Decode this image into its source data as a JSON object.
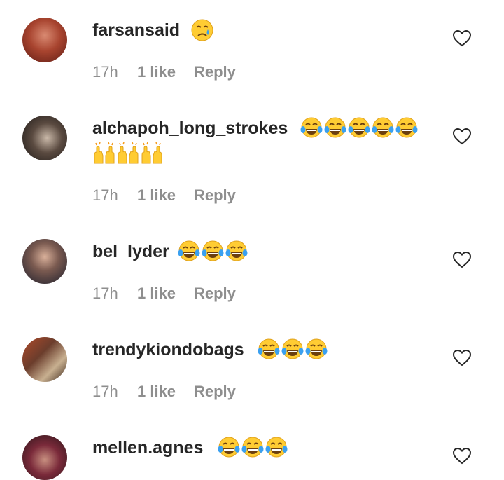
{
  "comments": [
    {
      "username": "farsansaid",
      "emoji_icon": "crying-face-emoji",
      "time": "17h",
      "likes": "1 like",
      "reply": "Reply",
      "avatar_color": "#9c3a2b"
    },
    {
      "username": "alchapoh_long_strokes",
      "emoji_icon": "tears-of-joy-emoji",
      "line2_icon": "raising-hands-emoji",
      "time": "17h",
      "likes": "1 like",
      "reply": "Reply",
      "avatar_color": "#3b3430"
    },
    {
      "username": "bel_lyder",
      "emoji_icon": "tears-of-joy-emoji",
      "time": "17h",
      "likes": "1 like",
      "reply": "Reply",
      "avatar_color": "#2a2a33"
    },
    {
      "username": "trendykiondobags",
      "emoji_icon": "tears-of-joy-emoji",
      "time": "17h",
      "likes": "1 like",
      "reply": "Reply",
      "avatar_color": "#6b3d2c"
    },
    {
      "username": "mellen.agnes",
      "emoji_icon": "tears-of-joy-emoji",
      "avatar_color": "#7a2a3a"
    }
  ],
  "colors": {
    "username": "#262626",
    "meta": "#8e8e8e",
    "emoji_yellow": "#ffcc33"
  }
}
